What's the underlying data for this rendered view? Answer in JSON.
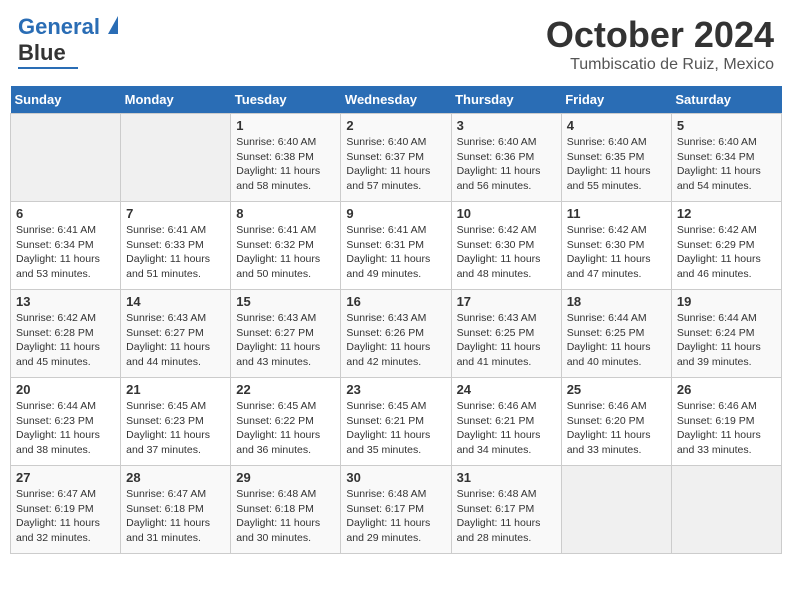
{
  "header": {
    "logo_line1": "General",
    "logo_line2": "Blue",
    "month": "October 2024",
    "location": "Tumbiscatio de Ruiz, Mexico"
  },
  "weekdays": [
    "Sunday",
    "Monday",
    "Tuesday",
    "Wednesday",
    "Thursday",
    "Friday",
    "Saturday"
  ],
  "weeks": [
    [
      {
        "day": "",
        "info": ""
      },
      {
        "day": "",
        "info": ""
      },
      {
        "day": "1",
        "info": "Sunrise: 6:40 AM\nSunset: 6:38 PM\nDaylight: 11 hours and 58 minutes."
      },
      {
        "day": "2",
        "info": "Sunrise: 6:40 AM\nSunset: 6:37 PM\nDaylight: 11 hours and 57 minutes."
      },
      {
        "day": "3",
        "info": "Sunrise: 6:40 AM\nSunset: 6:36 PM\nDaylight: 11 hours and 56 minutes."
      },
      {
        "day": "4",
        "info": "Sunrise: 6:40 AM\nSunset: 6:35 PM\nDaylight: 11 hours and 55 minutes."
      },
      {
        "day": "5",
        "info": "Sunrise: 6:40 AM\nSunset: 6:34 PM\nDaylight: 11 hours and 54 minutes."
      }
    ],
    [
      {
        "day": "6",
        "info": "Sunrise: 6:41 AM\nSunset: 6:34 PM\nDaylight: 11 hours and 53 minutes."
      },
      {
        "day": "7",
        "info": "Sunrise: 6:41 AM\nSunset: 6:33 PM\nDaylight: 11 hours and 51 minutes."
      },
      {
        "day": "8",
        "info": "Sunrise: 6:41 AM\nSunset: 6:32 PM\nDaylight: 11 hours and 50 minutes."
      },
      {
        "day": "9",
        "info": "Sunrise: 6:41 AM\nSunset: 6:31 PM\nDaylight: 11 hours and 49 minutes."
      },
      {
        "day": "10",
        "info": "Sunrise: 6:42 AM\nSunset: 6:30 PM\nDaylight: 11 hours and 48 minutes."
      },
      {
        "day": "11",
        "info": "Sunrise: 6:42 AM\nSunset: 6:30 PM\nDaylight: 11 hours and 47 minutes."
      },
      {
        "day": "12",
        "info": "Sunrise: 6:42 AM\nSunset: 6:29 PM\nDaylight: 11 hours and 46 minutes."
      }
    ],
    [
      {
        "day": "13",
        "info": "Sunrise: 6:42 AM\nSunset: 6:28 PM\nDaylight: 11 hours and 45 minutes."
      },
      {
        "day": "14",
        "info": "Sunrise: 6:43 AM\nSunset: 6:27 PM\nDaylight: 11 hours and 44 minutes."
      },
      {
        "day": "15",
        "info": "Sunrise: 6:43 AM\nSunset: 6:27 PM\nDaylight: 11 hours and 43 minutes."
      },
      {
        "day": "16",
        "info": "Sunrise: 6:43 AM\nSunset: 6:26 PM\nDaylight: 11 hours and 42 minutes."
      },
      {
        "day": "17",
        "info": "Sunrise: 6:43 AM\nSunset: 6:25 PM\nDaylight: 11 hours and 41 minutes."
      },
      {
        "day": "18",
        "info": "Sunrise: 6:44 AM\nSunset: 6:25 PM\nDaylight: 11 hours and 40 minutes."
      },
      {
        "day": "19",
        "info": "Sunrise: 6:44 AM\nSunset: 6:24 PM\nDaylight: 11 hours and 39 minutes."
      }
    ],
    [
      {
        "day": "20",
        "info": "Sunrise: 6:44 AM\nSunset: 6:23 PM\nDaylight: 11 hours and 38 minutes."
      },
      {
        "day": "21",
        "info": "Sunrise: 6:45 AM\nSunset: 6:23 PM\nDaylight: 11 hours and 37 minutes."
      },
      {
        "day": "22",
        "info": "Sunrise: 6:45 AM\nSunset: 6:22 PM\nDaylight: 11 hours and 36 minutes."
      },
      {
        "day": "23",
        "info": "Sunrise: 6:45 AM\nSunset: 6:21 PM\nDaylight: 11 hours and 35 minutes."
      },
      {
        "day": "24",
        "info": "Sunrise: 6:46 AM\nSunset: 6:21 PM\nDaylight: 11 hours and 34 minutes."
      },
      {
        "day": "25",
        "info": "Sunrise: 6:46 AM\nSunset: 6:20 PM\nDaylight: 11 hours and 33 minutes."
      },
      {
        "day": "26",
        "info": "Sunrise: 6:46 AM\nSunset: 6:19 PM\nDaylight: 11 hours and 33 minutes."
      }
    ],
    [
      {
        "day": "27",
        "info": "Sunrise: 6:47 AM\nSunset: 6:19 PM\nDaylight: 11 hours and 32 minutes."
      },
      {
        "day": "28",
        "info": "Sunrise: 6:47 AM\nSunset: 6:18 PM\nDaylight: 11 hours and 31 minutes."
      },
      {
        "day": "29",
        "info": "Sunrise: 6:48 AM\nSunset: 6:18 PM\nDaylight: 11 hours and 30 minutes."
      },
      {
        "day": "30",
        "info": "Sunrise: 6:48 AM\nSunset: 6:17 PM\nDaylight: 11 hours and 29 minutes."
      },
      {
        "day": "31",
        "info": "Sunrise: 6:48 AM\nSunset: 6:17 PM\nDaylight: 11 hours and 28 minutes."
      },
      {
        "day": "",
        "info": ""
      },
      {
        "day": "",
        "info": ""
      }
    ]
  ]
}
